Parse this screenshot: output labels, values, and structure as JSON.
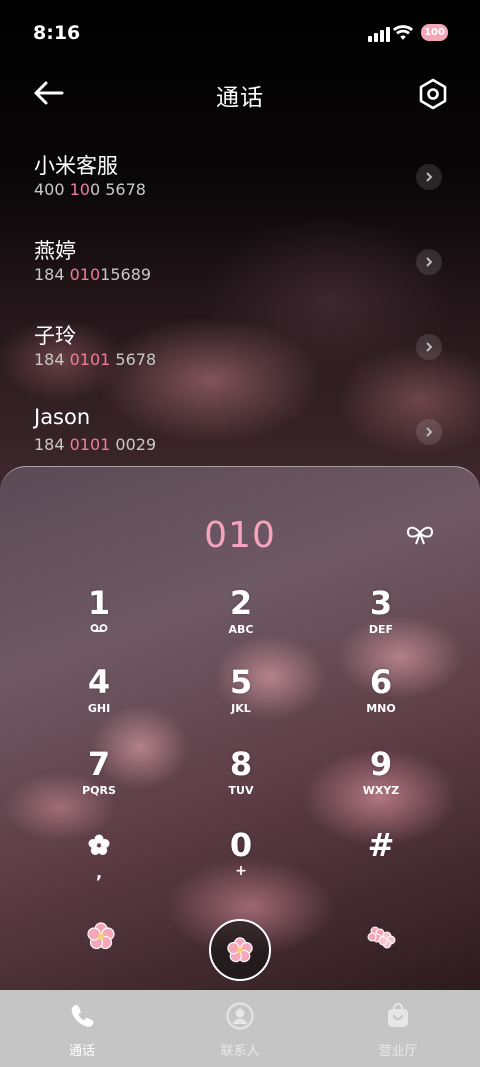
{
  "status_bar": {
    "time": "8:16",
    "battery": "100"
  },
  "header": {
    "title": "通话"
  },
  "recent_calls": [
    {
      "name": "小米客服",
      "number_parts": [
        {
          "text": "400 ",
          "hl": false
        },
        {
          "text": "10",
          "hl": true
        },
        {
          "text": "0 5678",
          "hl": false
        }
      ]
    },
    {
      "name": "燕婷",
      "number_parts": [
        {
          "text": "184 ",
          "hl": false
        },
        {
          "text": "010",
          "hl": true
        },
        {
          "text": "15689",
          "hl": false
        }
      ]
    },
    {
      "name": "子玲",
      "number_parts": [
        {
          "text": "184 ",
          "hl": false
        },
        {
          "text": "0101",
          "hl": true
        },
        {
          "text": " 5678",
          "hl": false
        }
      ]
    },
    {
      "name": "Jason",
      "number_parts": [
        {
          "text": "184 ",
          "hl": false
        },
        {
          "text": "0101",
          "hl": true
        },
        {
          "text": " 0029",
          "hl": false
        }
      ]
    }
  ],
  "dialpad": {
    "entered_digits": "010",
    "keys": [
      {
        "digit": "1",
        "letters": "voicemail-icon"
      },
      {
        "digit": "2",
        "letters": "ABC"
      },
      {
        "digit": "3",
        "letters": "DEF"
      },
      {
        "digit": "4",
        "letters": "GHI"
      },
      {
        "digit": "5",
        "letters": "JKL"
      },
      {
        "digit": "6",
        "letters": "MNO"
      },
      {
        "digit": "7",
        "letters": "PQRS"
      },
      {
        "digit": "8",
        "letters": "TUV"
      },
      {
        "digit": "9",
        "letters": "WXYZ"
      },
      {
        "digit": "*",
        "letters": ","
      },
      {
        "digit": "0",
        "letters": "+"
      },
      {
        "digit": "#",
        "letters": ""
      }
    ]
  },
  "bottom_nav": [
    {
      "label": "通话",
      "icon": "phone-icon",
      "active": true
    },
    {
      "label": "联系人",
      "icon": "person-icon",
      "active": false
    },
    {
      "label": "营业厅",
      "icon": "shop-bag-icon",
      "active": false
    }
  ],
  "colors": {
    "accent": "#f07b9a",
    "digits": "#f6a3bd",
    "tabbar": "#c5c5c5"
  }
}
